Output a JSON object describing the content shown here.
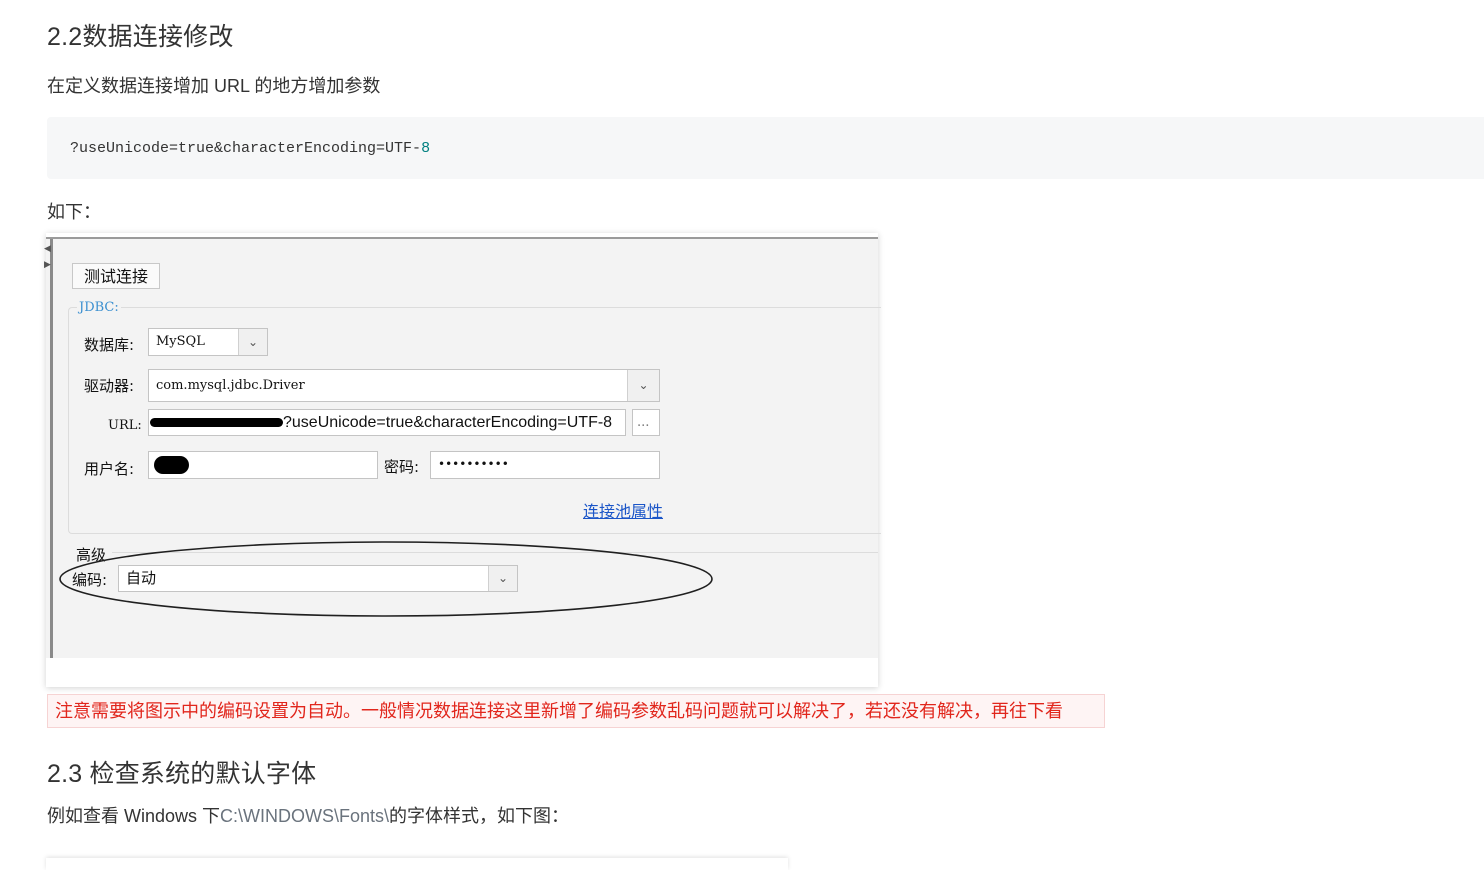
{
  "section_22": {
    "heading": "2.2数据连接修改",
    "intro": "在定义数据连接增加 URL 的地方增加参数",
    "code_text": "?useUnicode=true&characterEncoding=UTF-",
    "code_num": "8",
    "as_below": "如下："
  },
  "dialog": {
    "test_button": "测试连接",
    "group_label": "JDBC:",
    "database_label": "数据库:",
    "database_value": "MySQL",
    "driver_label": "驱动器:",
    "driver_value": "com.mysql.jdbc.Driver",
    "url_label": "URL:",
    "url_value": "?useUnicode=true&characterEncoding=UTF-8",
    "url_more": "...",
    "username_label": "用户名:",
    "password_label": "密码:",
    "password_value": "••••••••••",
    "pool_link": "连接池属性",
    "advanced_label": "高级",
    "encoding_label": "编码:",
    "encoding_value": "自动"
  },
  "note": {
    "text": "注意需要将图示中的编码设置为自动。一般情况数据连接这里新增了编码参数乱码问题就可以解决了，若还没有解决，再往下看"
  },
  "section_23": {
    "heading": "2.3 检查系统的默认字体",
    "intro_prefix": "例如查看 Windows 下",
    "intro_path": "C:\\WINDOWS\\Fonts\\",
    "intro_suffix": "的字体样式，如下图："
  },
  "colors": {
    "note_text": "#e1261c",
    "note_bg": "#fef4f4",
    "link": "#1a55c8",
    "code_bg": "#f6f7f8"
  }
}
